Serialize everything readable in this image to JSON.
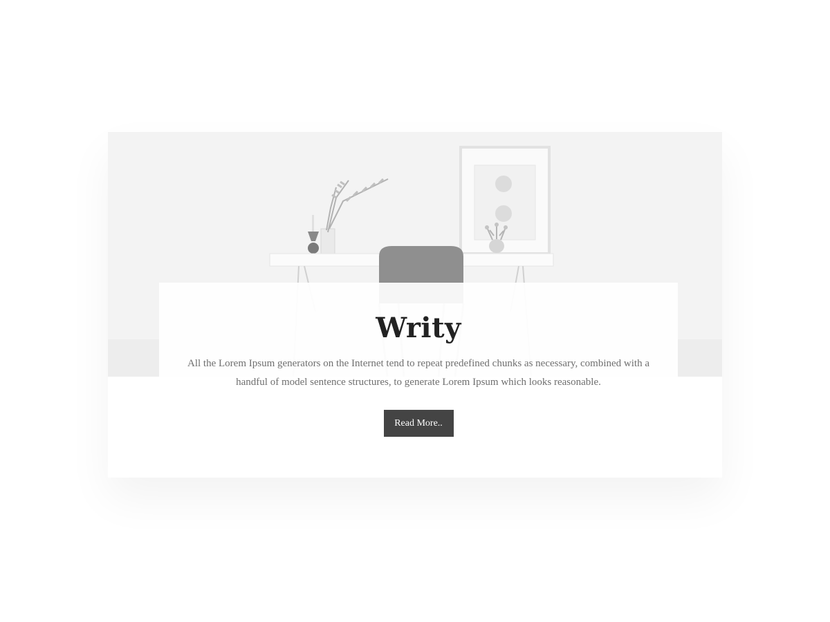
{
  "hero": {
    "image_alt": "minimal white desk with chair, vase and framed art"
  },
  "card": {
    "title": "Writy",
    "description": "All the Lorem Ipsum generators on the Internet tend to repeat predefined chunks as necessary, combined with a handful of model sentence structures, to generate Lorem Ipsum which looks reasonable.",
    "button_label": "Read More.."
  },
  "colors": {
    "button_bg": "#444444",
    "button_text": "#ffffff",
    "title": "#222222",
    "body_text": "#6f6f6f"
  }
}
